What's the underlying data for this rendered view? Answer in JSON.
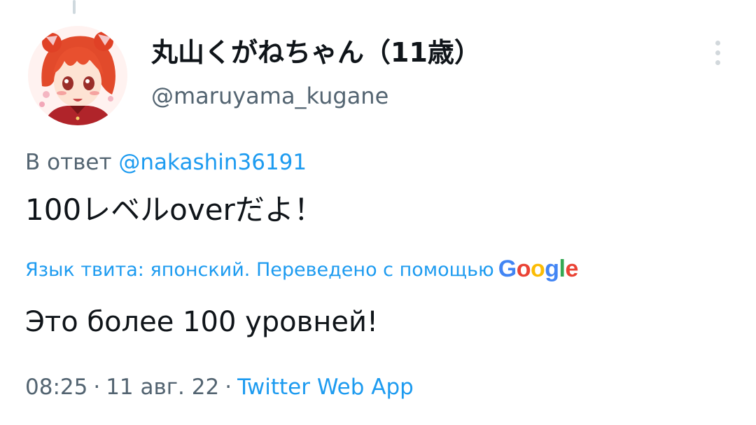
{
  "author": {
    "display_name": "丸山くがねちゃん（11歳）",
    "handle": "@maruyama_kugane",
    "avatar_icon": "avatar-anime-girl-red-hair"
  },
  "reply": {
    "prefix": "В ответ",
    "mention": "@nakashin36191"
  },
  "tweet": {
    "text": "100レベルoverだよ！"
  },
  "translation": {
    "label": "Язык твита: японский. Переведено с помощью",
    "provider_letters": [
      "G",
      "o",
      "o",
      "g",
      "l",
      "e"
    ],
    "translated_text": "Это более 100 уровней!"
  },
  "meta": {
    "time": "08:25",
    "separator": "·",
    "date": "11 авг. 22",
    "source": "Twitter Web App"
  },
  "menu": {
    "icon": "more-vertical-icon"
  },
  "colors": {
    "link": "#1d9bf0",
    "secondary_text": "#536471",
    "primary_text": "#0f1419",
    "google_blue": "#4285f4",
    "google_red": "#ea4335",
    "google_yellow": "#fbbc05",
    "google_green": "#34a853"
  }
}
